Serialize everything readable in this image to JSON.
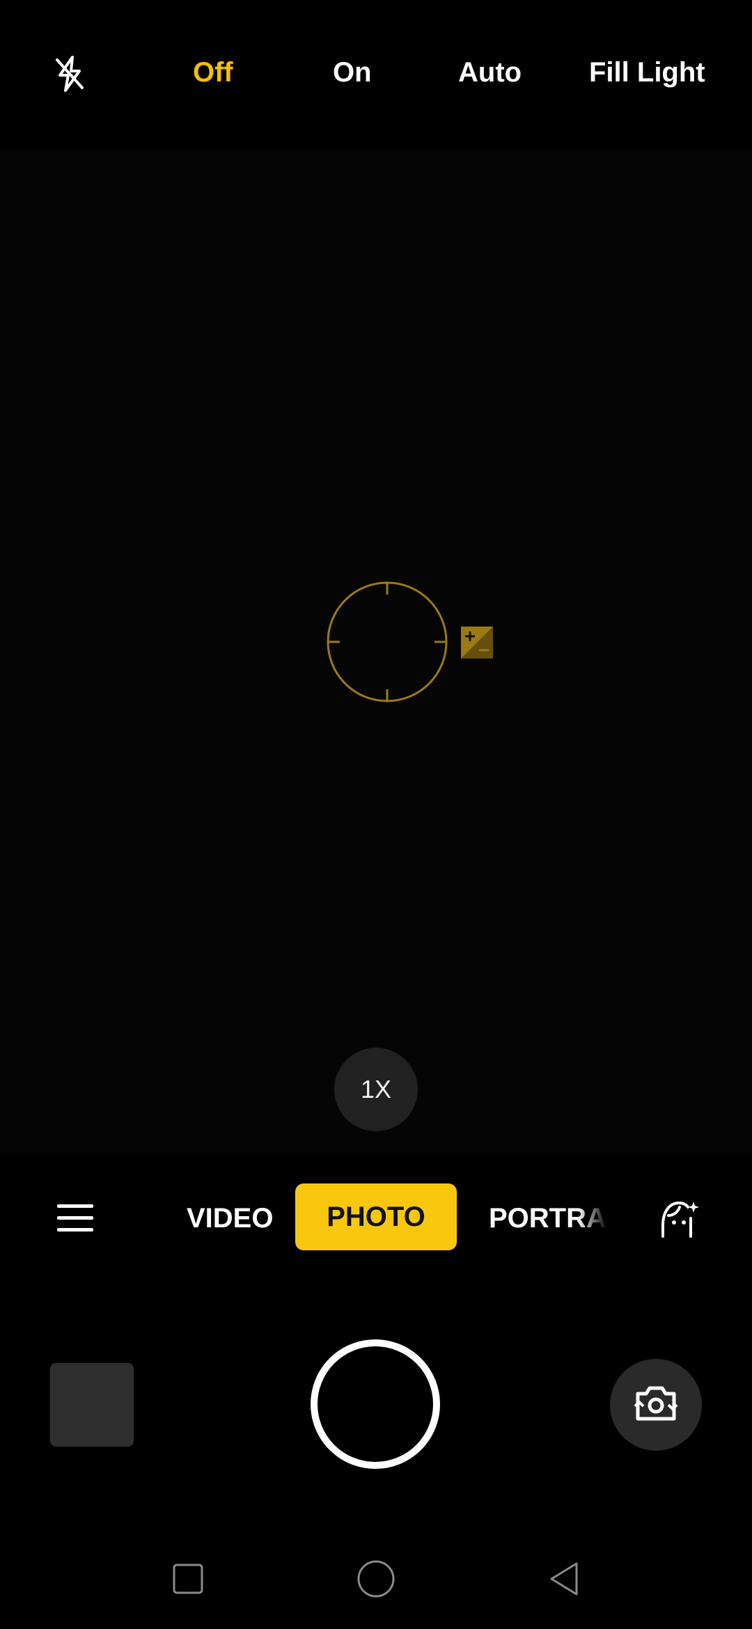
{
  "flash": {
    "icon": "flash-off-icon",
    "options": [
      {
        "label": "Off",
        "active": true
      },
      {
        "label": "On",
        "active": false
      },
      {
        "label": "Auto",
        "active": false
      },
      {
        "label": "Fill Light",
        "active": false
      }
    ]
  },
  "viewfinder": {
    "focus_icon": "focus-ring-icon",
    "exposure_icon": "exposure-compensation-icon",
    "zoom_label": "1X"
  },
  "modes": {
    "menu_icon": "menu-icon",
    "items": [
      {
        "label": "VIDEO",
        "selected": false
      },
      {
        "label": "PHOTO",
        "selected": true
      },
      {
        "label": "PORTRAIT",
        "selected": false
      }
    ],
    "beauty_icon": "beauty-face-icon"
  },
  "controls": {
    "thumbnail_icon": "gallery-thumbnail",
    "shutter_icon": "shutter-icon",
    "switch_icon": "switch-camera-icon"
  },
  "navigation": {
    "recent_icon": "recent-apps-icon",
    "home_icon": "home-icon",
    "back_icon": "back-icon"
  },
  "colors": {
    "accent": "#f6c000",
    "accent_fill": "#f9c80e",
    "focus_ring": "#9c7a10",
    "background": "#000000"
  }
}
